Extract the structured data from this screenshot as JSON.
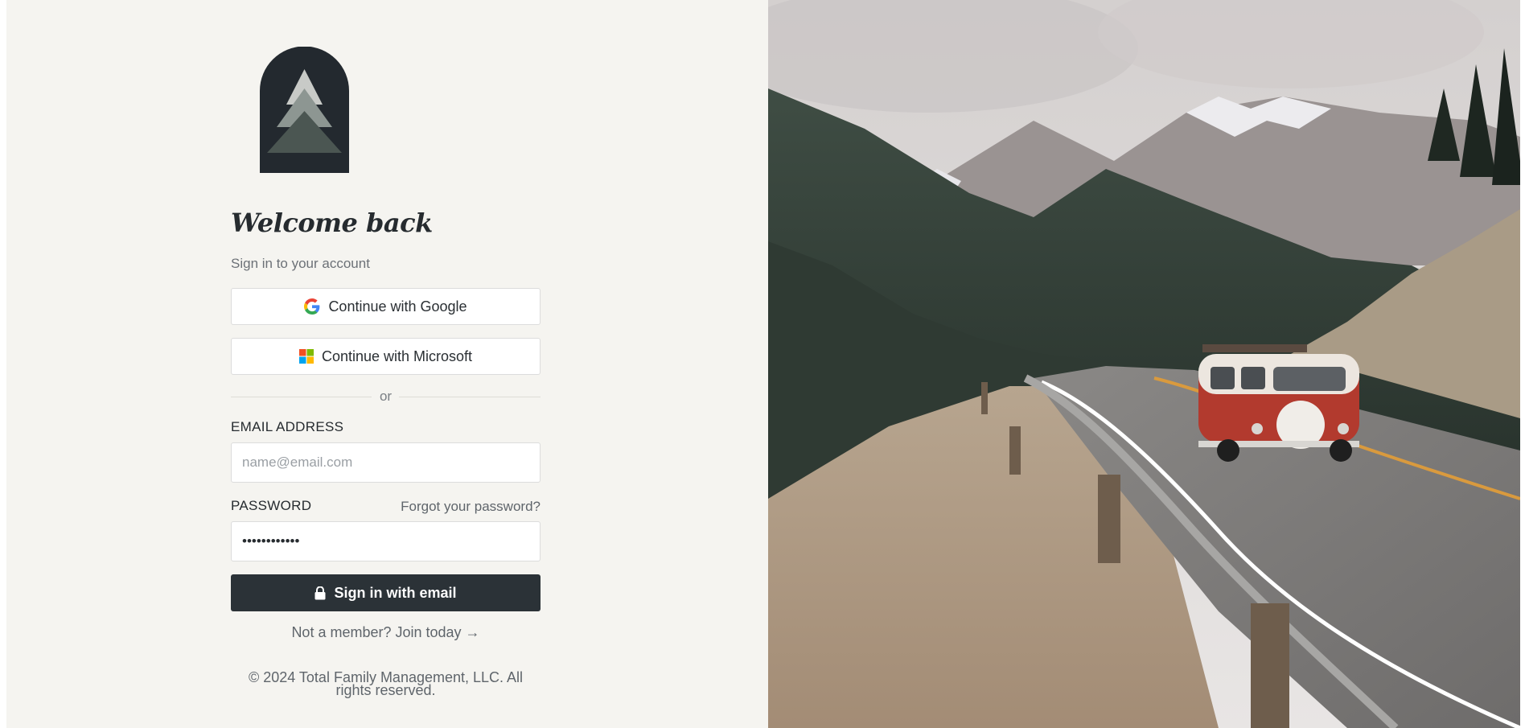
{
  "brand": {
    "logo_icon": "tree-arch-logo",
    "colors": {
      "logo_bg": "#23292f",
      "tree_light": "#c8cac7",
      "tree_mid": "#8d9692",
      "tree_dark": "#4b5652",
      "primary_button": "#2b3237",
      "page_bg": "#f5f4f0"
    }
  },
  "heading": {
    "title": "Welcome back",
    "subtitle": "Sign in to your account"
  },
  "sso": {
    "google_label": "Continue with Google",
    "google_icon": "google-icon",
    "microsoft_label": "Continue with Microsoft",
    "microsoft_icon": "microsoft-icon"
  },
  "divider": {
    "text": "or"
  },
  "form": {
    "email_label": "EMAIL ADDRESS",
    "email_placeholder": "name@email.com",
    "password_label": "PASSWORD",
    "forgot_link": "Forgot your password?",
    "password_value": "••••••••••••",
    "submit_label": "Sign in with email",
    "submit_icon": "lock-icon"
  },
  "join": {
    "text": "Not a member? Join today →"
  },
  "footer": {
    "copyright": "© 2024 Total Family Management, LLC. All rights reserved."
  },
  "hero": {
    "image": "mountain-road-van-photo"
  }
}
